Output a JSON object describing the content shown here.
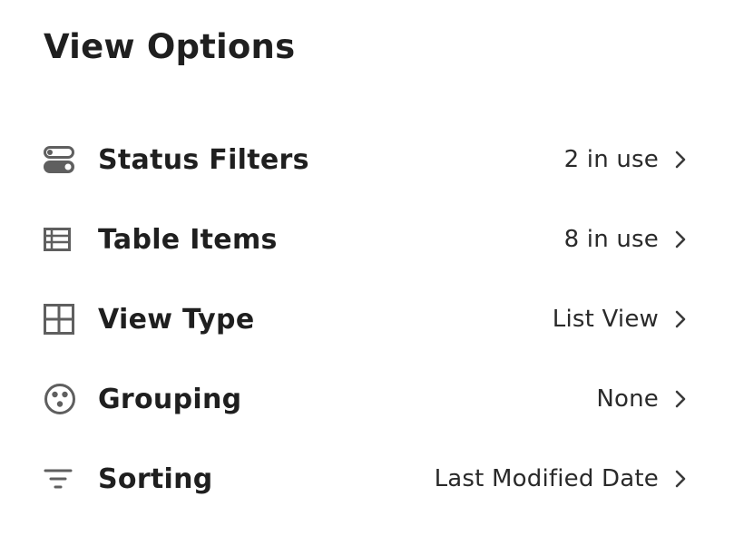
{
  "header": {
    "title": "View Options"
  },
  "colors": {
    "text": "#1f1f1f",
    "icon": "#5f5f5f",
    "background": "#ffffff"
  },
  "options": [
    {
      "label": "Status Filters",
      "value": "2 in use",
      "icon": "toggle-icon"
    },
    {
      "label": "Table Items",
      "value": "8 in use",
      "icon": "table-list-icon"
    },
    {
      "label": "View Type",
      "value": "List View",
      "icon": "grid-icon"
    },
    {
      "label": "Grouping",
      "value": "None",
      "icon": "group-dots-icon"
    },
    {
      "label": "Sorting",
      "value": "Last Modified Date",
      "icon": "sort-lines-icon"
    }
  ]
}
